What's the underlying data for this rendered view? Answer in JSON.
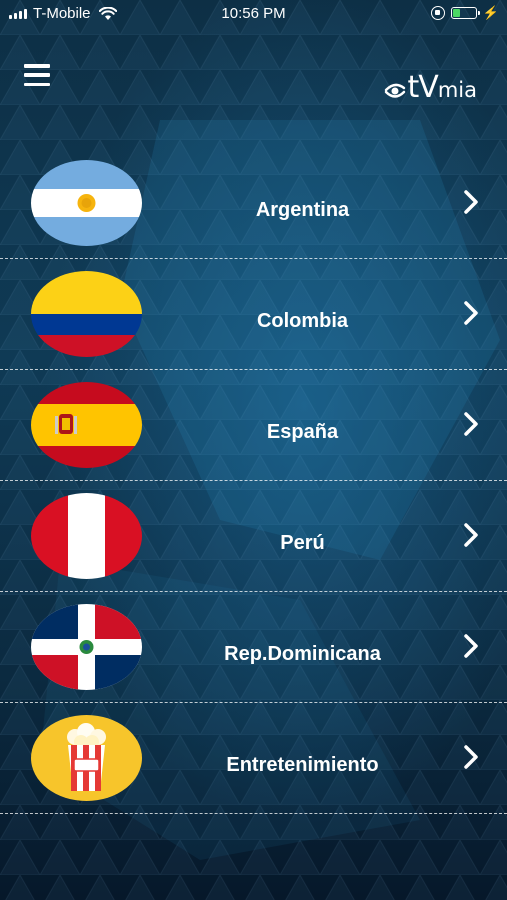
{
  "status_bar": {
    "carrier": "T-Mobile",
    "time": "10:56 PM",
    "battery_level": 0.35,
    "icons": [
      "signal-icon",
      "wifi-icon",
      "orientation-lock-icon",
      "battery-icon",
      "charging-bolt-icon"
    ]
  },
  "header": {
    "menu_icon": "hamburger-menu-icon",
    "logo_tv": "tV",
    "logo_mia": "mia"
  },
  "countries": [
    {
      "label": "Argentina",
      "icon": "flag-argentina-icon"
    },
    {
      "label": "Colombia",
      "icon": "flag-colombia-icon"
    },
    {
      "label": "España",
      "icon": "flag-spain-icon"
    },
    {
      "label": "Perú",
      "icon": "flag-peru-icon"
    },
    {
      "label": "Rep.Dominicana",
      "icon": "flag-dominican-republic-icon"
    },
    {
      "label": "Entretenimiento",
      "icon": "popcorn-icon"
    }
  ],
  "colors": {
    "background_dark": "#0d2f45",
    "background_accent": "#1e6ea0",
    "text": "#ffffff"
  }
}
